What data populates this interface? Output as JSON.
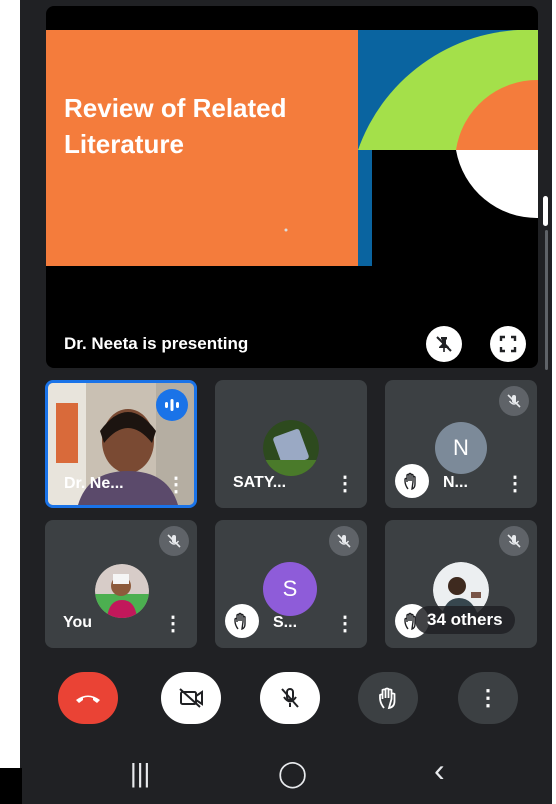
{
  "presentation": {
    "slide_title": "Review of Related Literature",
    "presenting_label": "Dr. Neeta is presenting"
  },
  "participants": [
    {
      "name": "Dr. Ne...",
      "speaking": true
    },
    {
      "name": "SATY...",
      "muted": false
    },
    {
      "name": "N...",
      "avatar_letter": "N",
      "hand_raised": true,
      "muted": true
    },
    {
      "name": "You",
      "muted": true
    },
    {
      "name": "S...",
      "avatar_letter": "S",
      "hand_raised": true,
      "muted": true
    },
    {
      "name": "",
      "hand_raised": true,
      "muted": true,
      "others_label": "34 others"
    }
  ],
  "controls": {
    "items": [
      "end-call",
      "camera-off",
      "mic-off",
      "raise-hand",
      "more-options"
    ]
  },
  "colors": {
    "slide_orange": "#f47c3c",
    "slide_blue": "#0a64a0",
    "slide_green": "#a4e04a",
    "end_call_red": "#ea4335",
    "speaking_blue": "#1a73e8",
    "avatar_n": "#7c8a99",
    "avatar_s": "#8e5cd9"
  },
  "navbar": {
    "recent": "|||",
    "home": "◯",
    "back": "‹"
  }
}
